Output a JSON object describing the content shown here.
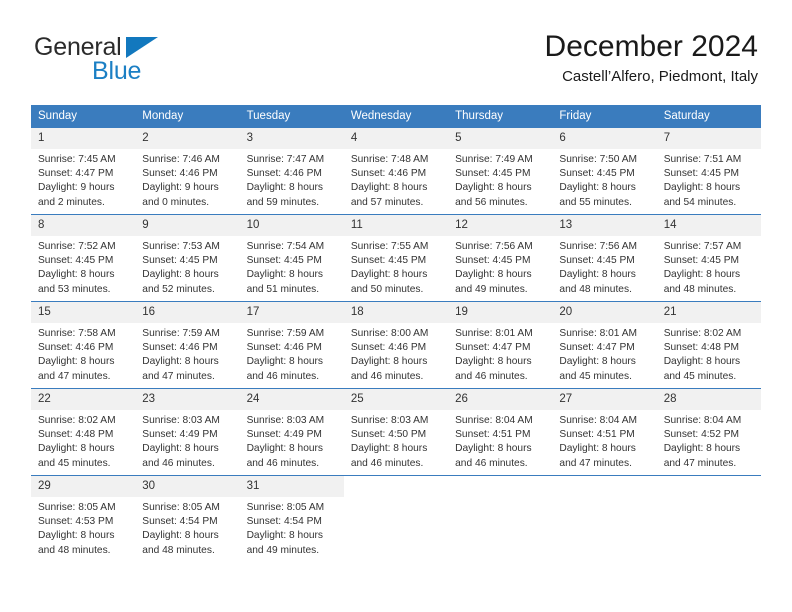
{
  "brand": {
    "name_top": "General",
    "name_bottom": "Blue",
    "triangle_color": "#1278be",
    "top_color": "#2b2b2b",
    "bottom_color": "#1b7fc4"
  },
  "header": {
    "title": "December 2024",
    "subtitle": "Castell’Alfero, Piedmont, Italy"
  },
  "theme": {
    "header_bg": "#3a7cbe",
    "header_text": "#ffffff",
    "daynum_bg": "#f1f1f1",
    "cell_bg": "#ffffff",
    "grid_line": "#3a7cbe",
    "body_text": "#333333"
  },
  "weekdays": [
    "Sunday",
    "Monday",
    "Tuesday",
    "Wednesday",
    "Thursday",
    "Friday",
    "Saturday"
  ],
  "weeks": [
    [
      {
        "day": "1",
        "sunrise": "Sunrise: 7:45 AM",
        "sunset": "Sunset: 4:47 PM",
        "daylight": "Daylight: 9 hours and 2 minutes."
      },
      {
        "day": "2",
        "sunrise": "Sunrise: 7:46 AM",
        "sunset": "Sunset: 4:46 PM",
        "daylight": "Daylight: 9 hours and 0 minutes."
      },
      {
        "day": "3",
        "sunrise": "Sunrise: 7:47 AM",
        "sunset": "Sunset: 4:46 PM",
        "daylight": "Daylight: 8 hours and 59 minutes."
      },
      {
        "day": "4",
        "sunrise": "Sunrise: 7:48 AM",
        "sunset": "Sunset: 4:46 PM",
        "daylight": "Daylight: 8 hours and 57 minutes."
      },
      {
        "day": "5",
        "sunrise": "Sunrise: 7:49 AM",
        "sunset": "Sunset: 4:45 PM",
        "daylight": "Daylight: 8 hours and 56 minutes."
      },
      {
        "day": "6",
        "sunrise": "Sunrise: 7:50 AM",
        "sunset": "Sunset: 4:45 PM",
        "daylight": "Daylight: 8 hours and 55 minutes."
      },
      {
        "day": "7",
        "sunrise": "Sunrise: 7:51 AM",
        "sunset": "Sunset: 4:45 PM",
        "daylight": "Daylight: 8 hours and 54 minutes."
      }
    ],
    [
      {
        "day": "8",
        "sunrise": "Sunrise: 7:52 AM",
        "sunset": "Sunset: 4:45 PM",
        "daylight": "Daylight: 8 hours and 53 minutes."
      },
      {
        "day": "9",
        "sunrise": "Sunrise: 7:53 AM",
        "sunset": "Sunset: 4:45 PM",
        "daylight": "Daylight: 8 hours and 52 minutes."
      },
      {
        "day": "10",
        "sunrise": "Sunrise: 7:54 AM",
        "sunset": "Sunset: 4:45 PM",
        "daylight": "Daylight: 8 hours and 51 minutes."
      },
      {
        "day": "11",
        "sunrise": "Sunrise: 7:55 AM",
        "sunset": "Sunset: 4:45 PM",
        "daylight": "Daylight: 8 hours and 50 minutes."
      },
      {
        "day": "12",
        "sunrise": "Sunrise: 7:56 AM",
        "sunset": "Sunset: 4:45 PM",
        "daylight": "Daylight: 8 hours and 49 minutes."
      },
      {
        "day": "13",
        "sunrise": "Sunrise: 7:56 AM",
        "sunset": "Sunset: 4:45 PM",
        "daylight": "Daylight: 8 hours and 48 minutes."
      },
      {
        "day": "14",
        "sunrise": "Sunrise: 7:57 AM",
        "sunset": "Sunset: 4:45 PM",
        "daylight": "Daylight: 8 hours and 48 minutes."
      }
    ],
    [
      {
        "day": "15",
        "sunrise": "Sunrise: 7:58 AM",
        "sunset": "Sunset: 4:46 PM",
        "daylight": "Daylight: 8 hours and 47 minutes."
      },
      {
        "day": "16",
        "sunrise": "Sunrise: 7:59 AM",
        "sunset": "Sunset: 4:46 PM",
        "daylight": "Daylight: 8 hours and 47 minutes."
      },
      {
        "day": "17",
        "sunrise": "Sunrise: 7:59 AM",
        "sunset": "Sunset: 4:46 PM",
        "daylight": "Daylight: 8 hours and 46 minutes."
      },
      {
        "day": "18",
        "sunrise": "Sunrise: 8:00 AM",
        "sunset": "Sunset: 4:46 PM",
        "daylight": "Daylight: 8 hours and 46 minutes."
      },
      {
        "day": "19",
        "sunrise": "Sunrise: 8:01 AM",
        "sunset": "Sunset: 4:47 PM",
        "daylight": "Daylight: 8 hours and 46 minutes."
      },
      {
        "day": "20",
        "sunrise": "Sunrise: 8:01 AM",
        "sunset": "Sunset: 4:47 PM",
        "daylight": "Daylight: 8 hours and 45 minutes."
      },
      {
        "day": "21",
        "sunrise": "Sunrise: 8:02 AM",
        "sunset": "Sunset: 4:48 PM",
        "daylight": "Daylight: 8 hours and 45 minutes."
      }
    ],
    [
      {
        "day": "22",
        "sunrise": "Sunrise: 8:02 AM",
        "sunset": "Sunset: 4:48 PM",
        "daylight": "Daylight: 8 hours and 45 minutes."
      },
      {
        "day": "23",
        "sunrise": "Sunrise: 8:03 AM",
        "sunset": "Sunset: 4:49 PM",
        "daylight": "Daylight: 8 hours and 46 minutes."
      },
      {
        "day": "24",
        "sunrise": "Sunrise: 8:03 AM",
        "sunset": "Sunset: 4:49 PM",
        "daylight": "Daylight: 8 hours and 46 minutes."
      },
      {
        "day": "25",
        "sunrise": "Sunrise: 8:03 AM",
        "sunset": "Sunset: 4:50 PM",
        "daylight": "Daylight: 8 hours and 46 minutes."
      },
      {
        "day": "26",
        "sunrise": "Sunrise: 8:04 AM",
        "sunset": "Sunset: 4:51 PM",
        "daylight": "Daylight: 8 hours and 46 minutes."
      },
      {
        "day": "27",
        "sunrise": "Sunrise: 8:04 AM",
        "sunset": "Sunset: 4:51 PM",
        "daylight": "Daylight: 8 hours and 47 minutes."
      },
      {
        "day": "28",
        "sunrise": "Sunrise: 8:04 AM",
        "sunset": "Sunset: 4:52 PM",
        "daylight": "Daylight: 8 hours and 47 minutes."
      }
    ],
    [
      {
        "day": "29",
        "sunrise": "Sunrise: 8:05 AM",
        "sunset": "Sunset: 4:53 PM",
        "daylight": "Daylight: 8 hours and 48 minutes."
      },
      {
        "day": "30",
        "sunrise": "Sunrise: 8:05 AM",
        "sunset": "Sunset: 4:54 PM",
        "daylight": "Daylight: 8 hours and 48 minutes."
      },
      {
        "day": "31",
        "sunrise": "Sunrise: 8:05 AM",
        "sunset": "Sunset: 4:54 PM",
        "daylight": "Daylight: 8 hours and 49 minutes."
      },
      {
        "day": "",
        "sunrise": "",
        "sunset": "",
        "daylight": ""
      },
      {
        "day": "",
        "sunrise": "",
        "sunset": "",
        "daylight": ""
      },
      {
        "day": "",
        "sunrise": "",
        "sunset": "",
        "daylight": ""
      },
      {
        "day": "",
        "sunrise": "",
        "sunset": "",
        "daylight": ""
      }
    ]
  ]
}
